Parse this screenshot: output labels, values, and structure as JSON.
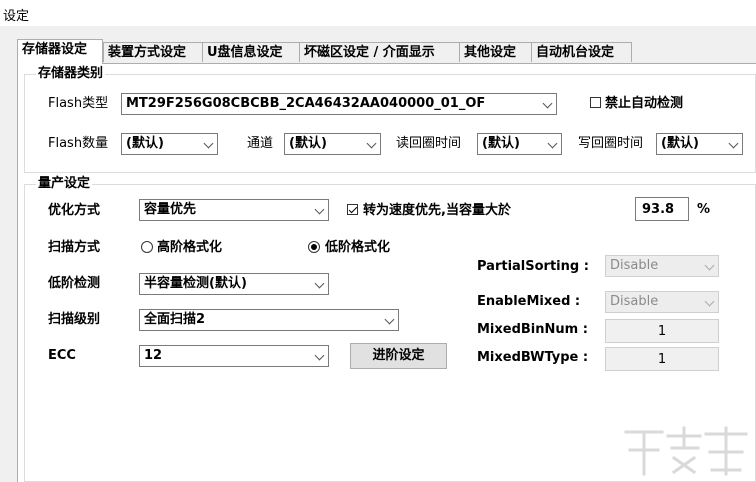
{
  "window": {
    "title": "设定"
  },
  "tabs": [
    {
      "label": "存储器设定",
      "active": true
    },
    {
      "label": "装置方式设定",
      "active": false
    },
    {
      "label": "U盘信息设定",
      "active": false
    },
    {
      "label": "坏磁区设定 / 介面显示",
      "active": false
    },
    {
      "label": "其他设定",
      "active": false
    },
    {
      "label": "自动机台设定",
      "active": false
    }
  ],
  "storage_type": {
    "group_title": "存储器类别",
    "flash_type_label": "Flash类型",
    "flash_type_value": "MT29F256G08CBCBB_2CA46432AA040000_01_OF",
    "disable_auto_detect_label": "禁止自动检测",
    "disable_auto_detect_checked": false,
    "flash_count_label": "Flash数量",
    "flash_count_value": "(默认)",
    "channel_label": "通道",
    "channel_value": "(默认)",
    "read_cycle_label": "读回圈时间",
    "read_cycle_value": "(默认)",
    "write_cycle_label": "写回圈时间",
    "write_cycle_value": "(默认)"
  },
  "production": {
    "group_title": "量产设定",
    "optimize_label": "优化方式",
    "optimize_value": "容量优先",
    "speed_checkbox_label": "转为速度优先,当容量大於",
    "speed_checkbox_checked": true,
    "speed_threshold": "93.8",
    "percent_symbol": "%",
    "scan_mode_label": "扫描方式",
    "scan_mode_options": [
      "高阶格式化",
      "低阶格式化"
    ],
    "scan_mode_selected": 1,
    "low_detect_label": "低阶检测",
    "low_detect_value": "半容量检测(默认)",
    "scan_level_label": "扫描级别",
    "scan_level_value": "全面扫描2",
    "ecc_label": "ECC",
    "ecc_value": "12",
    "advanced_button": "进阶设定",
    "partial_sorting_label": "PartialSorting :",
    "partial_sorting_value": "Disable",
    "enable_mixed_label": "EnableMixed :",
    "enable_mixed_value": "Disable",
    "mixed_bin_num_label": "MixedBinNum :",
    "mixed_bin_num_value": "1",
    "mixed_bw_type_label": "MixedBWType :",
    "mixed_bw_type_value": "1"
  },
  "colors": {
    "panel_bg": "#ffffff",
    "window_bg": "#f0f0f0",
    "border": "#adadad",
    "disabled": "#ededed"
  }
}
